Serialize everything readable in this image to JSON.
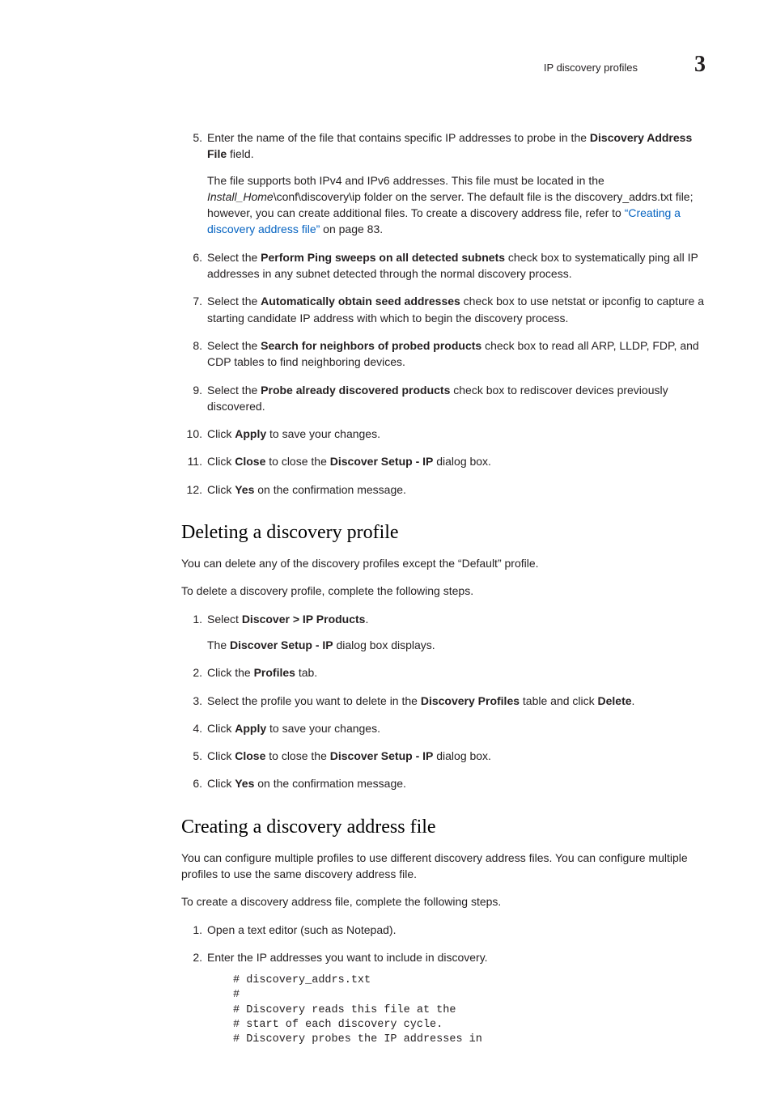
{
  "header": {
    "label": "IP discovery profiles",
    "chapter": "3"
  },
  "section_a": {
    "steps": [
      {
        "n": "5.",
        "p1_a": "Enter the name of the file that contains specific IP addresses to probe in the ",
        "p1_b": "Discovery Address File",
        "p1_c": " field.",
        "p2_a": "The file supports both IPv4 and IPv6 addresses. This file must be located in the ",
        "p2_italic": "Install_Home",
        "p2_b": "\\conf\\discovery\\ip folder on the server. The default file is the discovery_addrs.txt file; however, you can create additional files. To create a discovery address file, refer to ",
        "p2_link": "“Creating a discovery address file”",
        "p2_c": " on page 83."
      },
      {
        "n": "6.",
        "p1_a": "Select the ",
        "p1_b": "Perform Ping sweeps on all detected subnets",
        "p1_c": " check box to systematically ping all IP addresses in any subnet detected through the normal discovery process."
      },
      {
        "n": "7.",
        "p1_a": "Select the ",
        "p1_b": "Automatically obtain seed addresses",
        "p1_c": " check box to use netstat or ipconfig to capture a starting candidate IP address with which to begin the discovery process."
      },
      {
        "n": "8.",
        "p1_a": "Select the ",
        "p1_b": "Search for neighbors of probed products",
        "p1_c": " check box to read all ARP, LLDP, FDP, and CDP tables to find neighboring devices."
      },
      {
        "n": "9.",
        "p1_a": "Select the ",
        "p1_b": "Probe already discovered products",
        "p1_c": " check box to rediscover devices previously discovered."
      },
      {
        "n": "10.",
        "p1_a": "Click ",
        "p1_b": "Apply",
        "p1_c": " to save your changes."
      },
      {
        "n": "11.",
        "p1_a": "Click ",
        "p1_b": "Close",
        "p1_c": " to close the ",
        "p1_d": "Discover Setup - IP",
        "p1_e": " dialog box."
      },
      {
        "n": "12.",
        "p1_a": "Click ",
        "p1_b": "Yes",
        "p1_c": " on the confirmation message."
      }
    ]
  },
  "section_b": {
    "heading": "Deleting a discovery profile",
    "intro1": "You can delete any of the discovery profiles except the “Default” profile.",
    "intro2": "To delete a discovery profile, complete the following steps.",
    "steps": [
      {
        "n": "1.",
        "p1_a": "Select ",
        "p1_b": "Discover > IP Products",
        "p1_c": ".",
        "p2_a": "The ",
        "p2_b": "Discover Setup - IP",
        "p2_c": " dialog box displays."
      },
      {
        "n": "2.",
        "p1_a": "Click the ",
        "p1_b": "Profiles",
        "p1_c": " tab."
      },
      {
        "n": "3.",
        "p1_a": "Select the profile you want to delete in the ",
        "p1_b": "Discovery Profiles",
        "p1_c": " table and click ",
        "p1_d": "Delete",
        "p1_e": "."
      },
      {
        "n": "4.",
        "p1_a": "Click ",
        "p1_b": "Apply",
        "p1_c": " to save your changes."
      },
      {
        "n": "5.",
        "p1_a": "Click ",
        "p1_b": "Close",
        "p1_c": " to close the ",
        "p1_d": "Discover Setup - IP",
        "p1_e": " dialog box."
      },
      {
        "n": "6.",
        "p1_a": "Click ",
        "p1_b": "Yes",
        "p1_c": " on the confirmation message."
      }
    ]
  },
  "section_c": {
    "heading": "Creating a discovery address file",
    "intro1": "You can configure multiple profiles to use different discovery address files. You can configure multiple profiles to use the same discovery address file.",
    "intro2": "To create a discovery address file, complete the following steps.",
    "steps": [
      {
        "n": "1.",
        "p1_a": "Open a text editor (such as Notepad)."
      },
      {
        "n": "2.",
        "p1_a": "Enter the IP addresses you want to include in discovery."
      }
    ],
    "code": "# discovery_addrs.txt\n#\n# Discovery reads this file at the\n# start of each discovery cycle.\n# Discovery probes the IP addresses in"
  }
}
